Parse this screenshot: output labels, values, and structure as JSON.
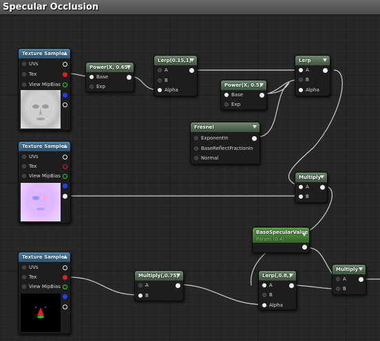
{
  "window": {
    "title": "Specular Occlusion"
  },
  "texture_nodes": [
    {
      "title": "Texture Sample",
      "pins": [
        "UVs",
        "Tex",
        "View MipBias"
      ]
    },
    {
      "title": "Texture Sample",
      "pins": [
        "UVs",
        "Tex",
        "View MipBias"
      ]
    },
    {
      "title": "Texture Sample",
      "pins": [
        "UVs",
        "Tex",
        "View MipBias"
      ]
    }
  ],
  "power1": {
    "title": "Power(X, 0.65)",
    "pins": [
      "Base",
      "Exp"
    ]
  },
  "lerp1": {
    "title": "Lerp(0.15,1)",
    "pins": [
      "A",
      "B",
      "Alpha"
    ]
  },
  "power2": {
    "title": "Power(X, 0.5)",
    "pins": [
      "Base",
      "Exp"
    ]
  },
  "lerp2": {
    "title": "Lerp",
    "pins": [
      "A",
      "B",
      "Alpha"
    ]
  },
  "fresnel": {
    "title": "Fresnel",
    "pins": [
      "ExponentIn",
      "BaseReflectFractionIn",
      "Normal"
    ]
  },
  "multiply1": {
    "title": "Multiply",
    "pins": [
      "A",
      "B"
    ]
  },
  "param": {
    "title": "BaseSpecularValue",
    "subtitle": "Param (0.4)"
  },
  "multiply2": {
    "title": "Multiply(,0.75)",
    "pins": [
      "A",
      "B"
    ]
  },
  "lerp3": {
    "title": "Lerp(,0.8,)",
    "pins": [
      "A",
      "B",
      "Alpha"
    ]
  },
  "multiply3": {
    "title": "Multiply",
    "pins": [
      "A",
      "B"
    ]
  },
  "colors": {
    "texture_header": "#3d6d90",
    "math_header": "#556f55",
    "param_header": "#478236",
    "pin_red": "#e02020",
    "pin_green": "#20e020",
    "pin_blue": "#2040ff",
    "wire": "#d0d0d0"
  }
}
